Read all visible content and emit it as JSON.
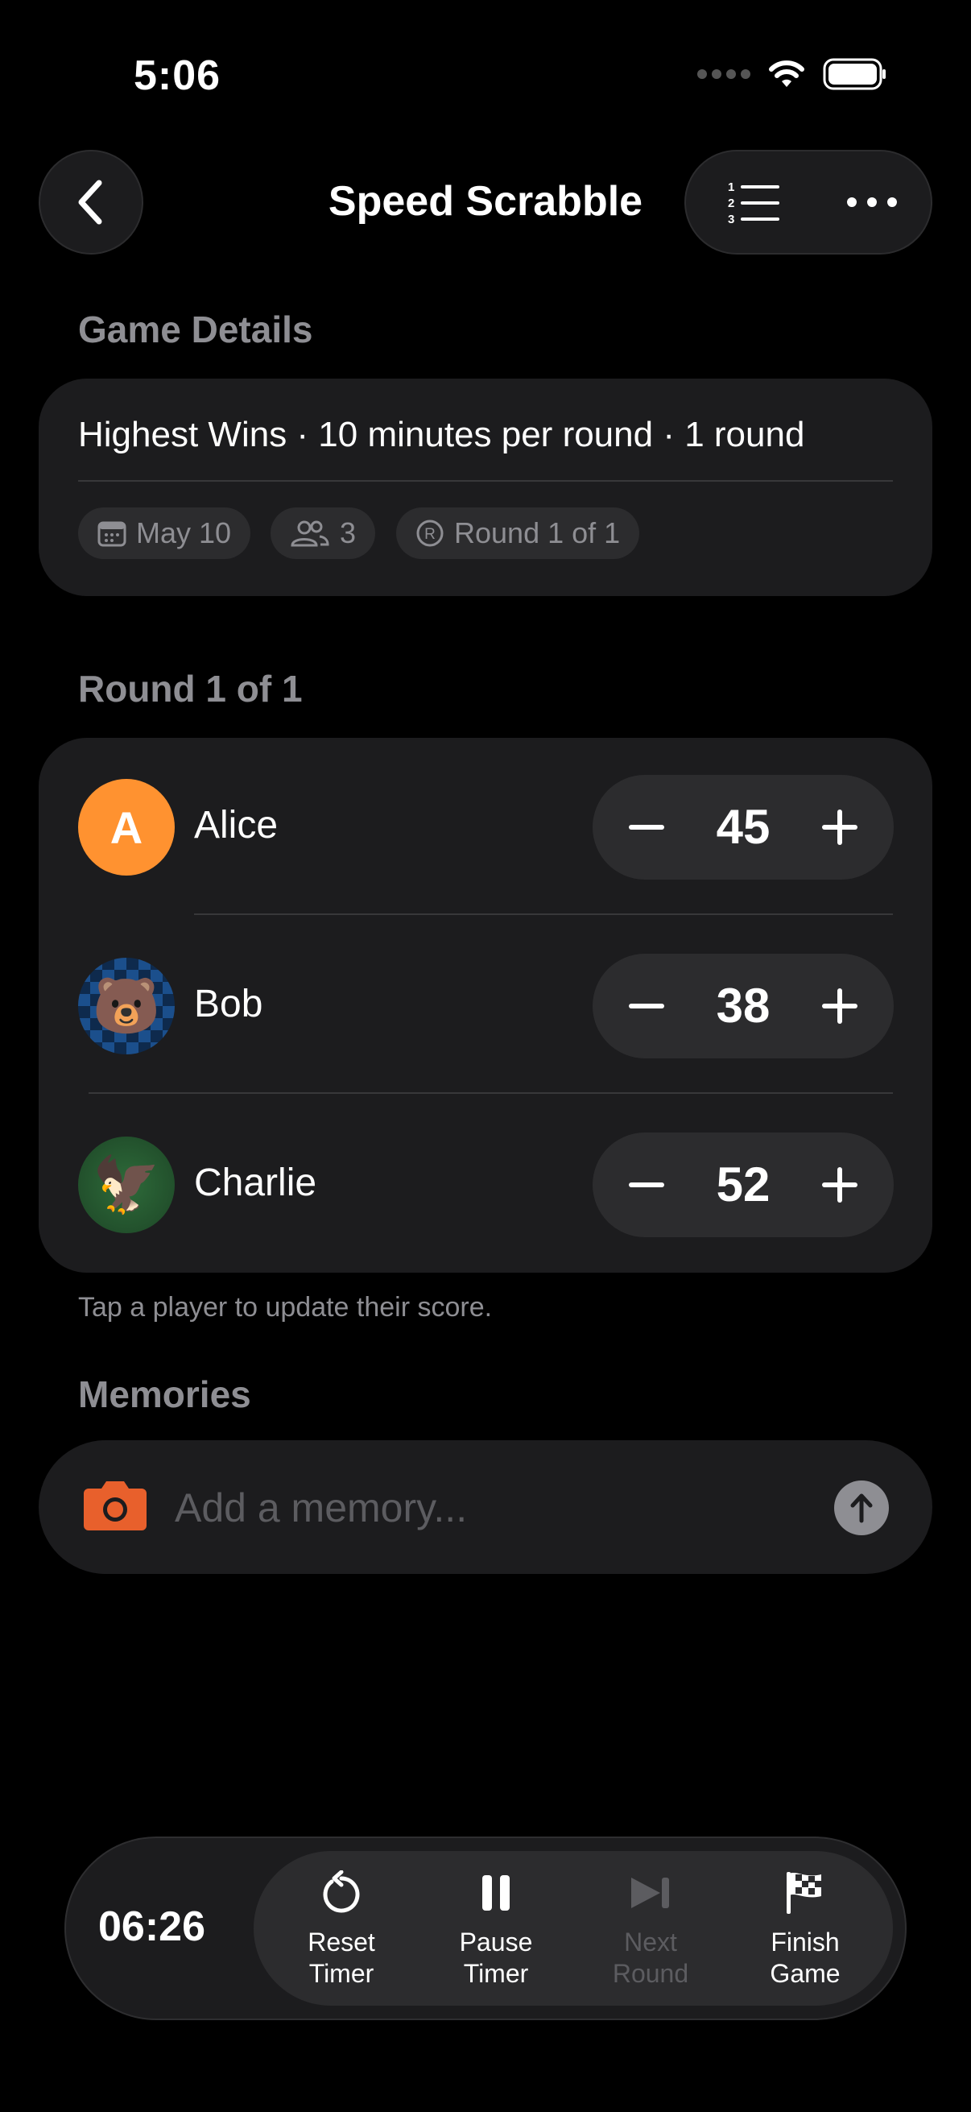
{
  "status_bar": {
    "time": "5:06"
  },
  "nav": {
    "title": "Speed Scrabble"
  },
  "game_details": {
    "header": "Game Details",
    "summary": "Highest Wins · 10 minutes per round · 1 round",
    "chips": {
      "date": "May 10",
      "players": "3",
      "round": "Round 1 of 1"
    }
  },
  "round": {
    "header": "Round 1 of 1",
    "players": [
      {
        "name": "Alice",
        "initial": "A",
        "score": "45",
        "avatar_color": "#ff9230"
      },
      {
        "name": "Bob",
        "avatar_emoji": "🐻",
        "score": "38"
      },
      {
        "name": "Charlie",
        "avatar_emoji": "🦅",
        "score": "52"
      }
    ],
    "hint": "Tap a player to update their score."
  },
  "memories": {
    "header": "Memories",
    "placeholder": "Add a memory..."
  },
  "timer": {
    "display": "06:26",
    "actions": [
      {
        "label_1": "Reset",
        "label_2": "Timer",
        "icon": "reset-icon"
      },
      {
        "label_1": "Pause",
        "label_2": "Timer",
        "icon": "pause-icon"
      },
      {
        "label_1": "Next",
        "label_2": "Round",
        "icon": "next-icon",
        "disabled": true
      },
      {
        "label_1": "Finish",
        "label_2": "Game",
        "icon": "checkered-flag-icon"
      }
    ]
  },
  "colors": {
    "accent_orange": "#ff9230",
    "camera": "#e8602c",
    "card": "#1c1c1e"
  }
}
